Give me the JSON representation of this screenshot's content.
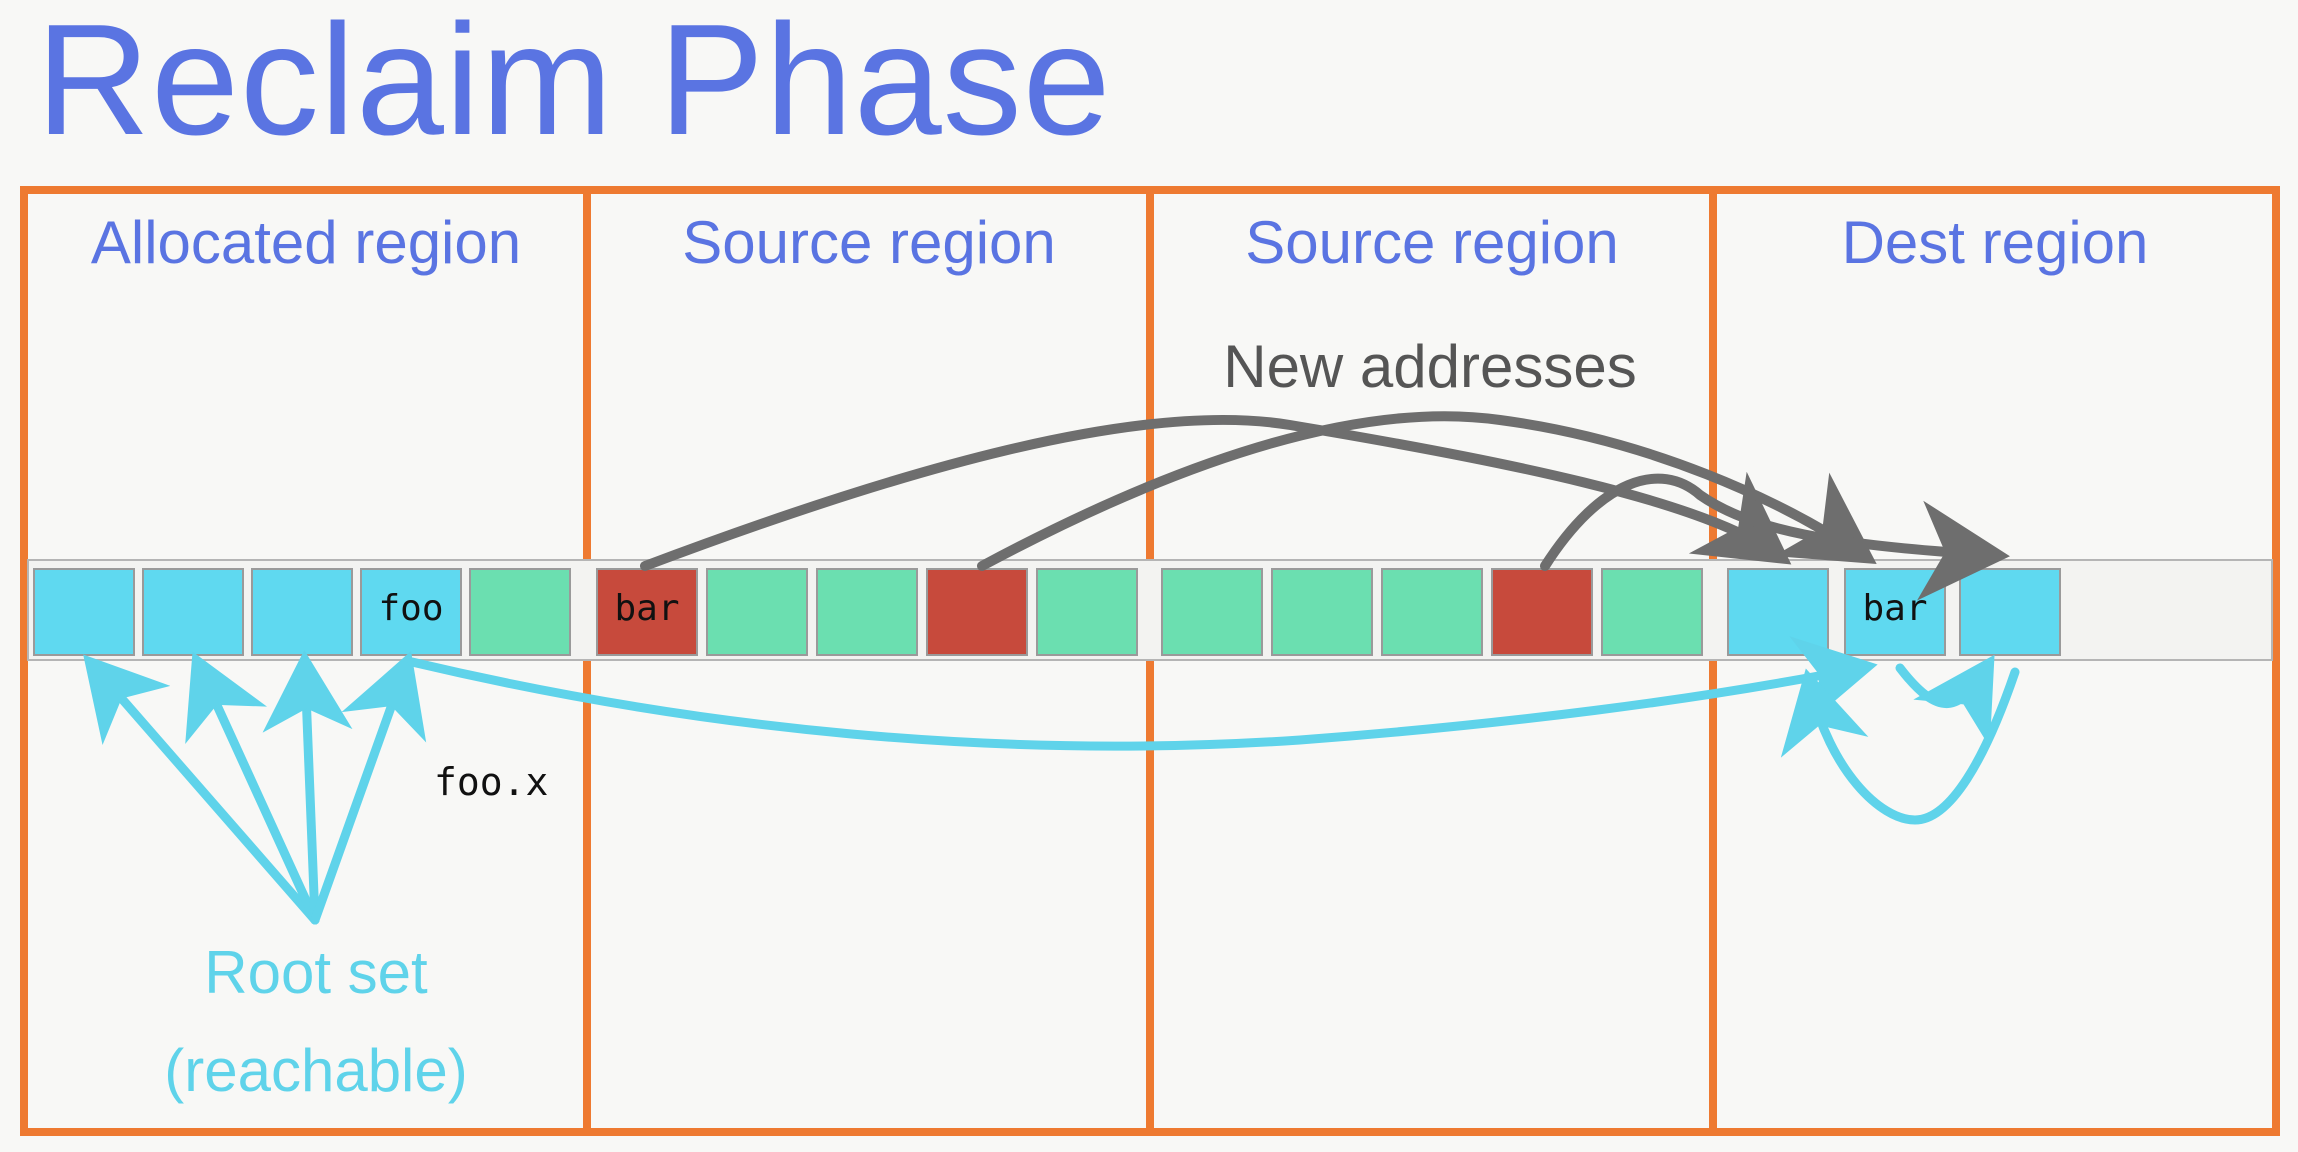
{
  "title": "Reclaim Phase",
  "regions": [
    {
      "label": "Allocated region"
    },
    {
      "label": "Source region"
    },
    {
      "label": "Source region"
    },
    {
      "label": "Dest region"
    }
  ],
  "annotations": {
    "new_addresses": "New addresses",
    "field_ref": "foo.x",
    "root_set_line1": "Root set",
    "root_set_line2": "(reachable)"
  },
  "cell_labels": {
    "foo": "foo",
    "bar_source": "bar",
    "bar_dest": "bar"
  },
  "legend_colors": {
    "region_border": "#ee7a31",
    "reachable_cell": "#5fd9f0",
    "live_object_cell": "#6bdfb0",
    "reclaimed_object_cell": "#c74a3c",
    "pointer_arrow": "#5fd3ea",
    "relocation_arrow": "#6e6e6e",
    "title_color": "#5a74e2"
  },
  "cells": [
    {
      "region": 0,
      "kind": "reachable",
      "label": ""
    },
    {
      "region": 0,
      "kind": "reachable",
      "label": ""
    },
    {
      "region": 0,
      "kind": "reachable",
      "label": ""
    },
    {
      "region": 0,
      "kind": "reachable",
      "label": "foo"
    },
    {
      "region": 0,
      "kind": "live",
      "label": ""
    },
    {
      "region": 1,
      "kind": "reclaimed",
      "label": "bar"
    },
    {
      "region": 1,
      "kind": "live",
      "label": ""
    },
    {
      "region": 1,
      "kind": "live",
      "label": ""
    },
    {
      "region": 1,
      "kind": "reclaimed",
      "label": ""
    },
    {
      "region": 1,
      "kind": "live",
      "label": ""
    },
    {
      "region": 2,
      "kind": "live",
      "label": ""
    },
    {
      "region": 2,
      "kind": "live",
      "label": ""
    },
    {
      "region": 2,
      "kind": "live",
      "label": ""
    },
    {
      "region": 2,
      "kind": "reclaimed",
      "label": ""
    },
    {
      "region": 2,
      "kind": "live",
      "label": ""
    },
    {
      "region": 3,
      "kind": "reachable",
      "label": ""
    },
    {
      "region": 3,
      "kind": "reachable",
      "label": "bar"
    },
    {
      "region": 3,
      "kind": "reachable",
      "label": ""
    }
  ]
}
